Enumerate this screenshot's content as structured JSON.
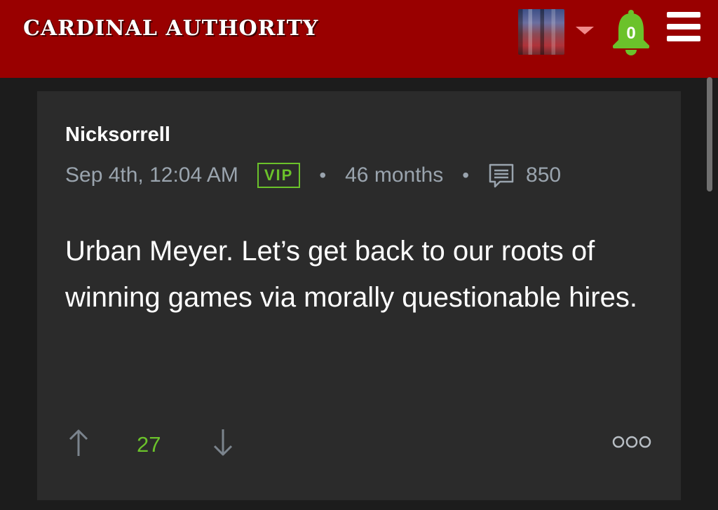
{
  "header": {
    "logo_text": "CARDINAL AUTHORITY",
    "notification_count": "0",
    "colors": {
      "header_bg": "#990000",
      "bell": "#6bc22b",
      "caret": "#f08a8a"
    },
    "icons": [
      "avatar",
      "chevron-down-icon",
      "bell-icon",
      "hamburger-menu-icon"
    ]
  },
  "post": {
    "author": "Nicksorrell",
    "timestamp": "Sep 4th, 12:04 AM",
    "badge": "VIP",
    "separator": "•",
    "membership": "46 months",
    "comment_count": "850",
    "body": "Urban Meyer. Let’s get back to our roots of winning games via morally questionable hires.",
    "vote_score": "27",
    "colors": {
      "card_bg": "#2b2b2b",
      "accent_green": "#6bc22b",
      "meta_gray": "#9aa4ae"
    },
    "icons": [
      "comment-icon",
      "upvote-arrow-icon",
      "downvote-arrow-icon",
      "more-options-icon"
    ]
  }
}
